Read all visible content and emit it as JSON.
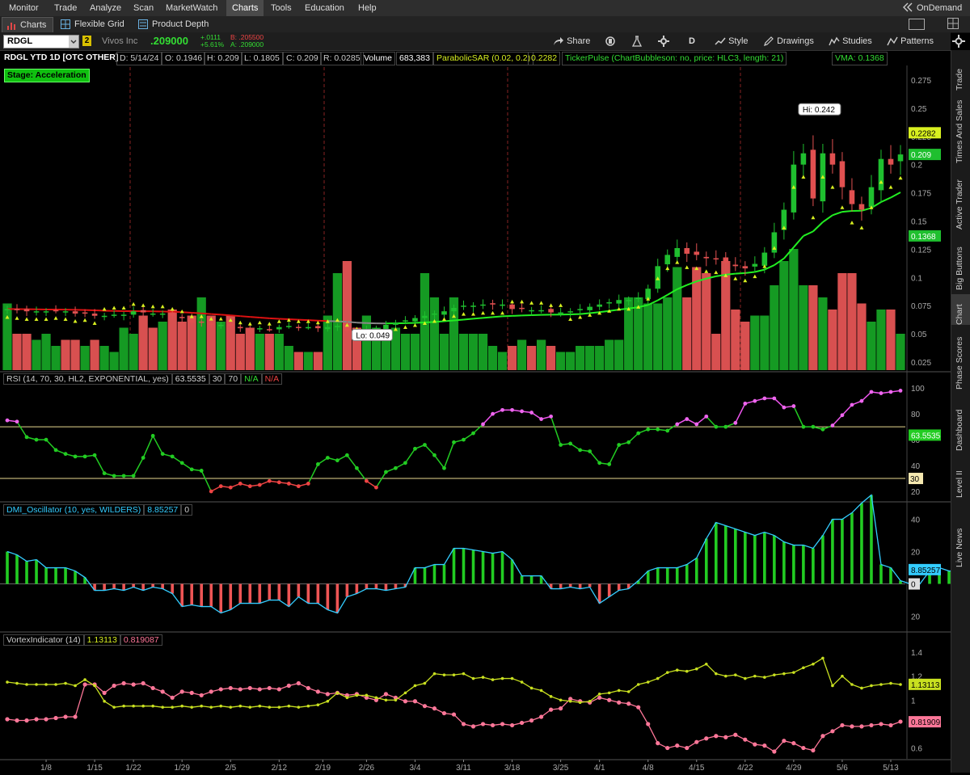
{
  "menubar": {
    "items": [
      "Monitor",
      "Trade",
      "Analyze",
      "Scan",
      "MarketWatch",
      "Charts",
      "Tools",
      "Education",
      "Help"
    ],
    "active": "Charts",
    "ondemand": "OnDemand"
  },
  "tabs": [
    "Charts",
    "Flexible Grid",
    "Product Depth"
  ],
  "symbol_bar": {
    "symbol": "RDGL",
    "link_badge": "2",
    "company": "Vivos Inc",
    "last": ".209000",
    "change": "+.0111",
    "change_pct": "+5.61%",
    "bid": "B: .205500",
    "ask": "A: .209000",
    "share": "Share",
    "period": "D",
    "style": "Style",
    "drawings": "Drawings",
    "studies": "Studies",
    "patterns": "Patterns"
  },
  "study_header": {
    "title": "RDGL YTD 1D [OTC OTHER]",
    "date": "D: 5/14/24",
    "open": "O: 0.1946",
    "high": "H: 0.209",
    "low": "L: 0.1805",
    "close": "C: 0.209",
    "range": "R: 0.0285",
    "volume_label": "Volume",
    "volume": "683,383",
    "psar_label": "ParabolicSAR (0.02, 0.2)",
    "psar": "0.2282",
    "tickerpulse": "TickerPulse (ChartBubbleson: no, price: HLC3, length: 21)",
    "vma": "VMA: 0.1368"
  },
  "stage_label": "Stage: Acceleration",
  "price_panel": {
    "y_ticks": [
      "0.275",
      "0.25",
      "0.225",
      "0.2",
      "0.175",
      "0.15",
      "0.125",
      "0.1",
      "0.075",
      "0.05",
      "0.025"
    ],
    "hi_bubble": "Hi: 0.242",
    "lo_bubble": "Lo: 0.049",
    "tag_psar": "0.2282",
    "tag_last": "0.209",
    "tag_vma": "0.1368",
    "colors": {
      "up": "#18a828",
      "down": "#e04848",
      "psar": "#d8f020",
      "vma_up": "#22ee22",
      "vma_down": "#dd1111"
    }
  },
  "rsi_panel": {
    "label": "RSI (14, 70, 30, HL2, EXPONENTIAL, yes)",
    "value": "63.5535",
    "ob": "30",
    "os": "70",
    "na1": "N/A",
    "na2": "N/A",
    "y_ticks": [
      "100",
      "80",
      "60",
      "40",
      "20"
    ],
    "tag_value": "63.5535",
    "tag_os": "30"
  },
  "dmi_panel": {
    "label": "DMI_Oscillator (10, yes, WILDERS)",
    "value": "8.85257",
    "zero": "0",
    "y_ticks": [
      "40",
      "20",
      "20"
    ],
    "tag_value": "8.85257",
    "tag_zero": "0"
  },
  "vortex_panel": {
    "label": "VortexIndicator (14)",
    "vi_plus": "1.13113",
    "vi_minus": "0.819087",
    "y_ticks": [
      "1.4",
      "1.2",
      "1",
      "0.8",
      "0.6"
    ],
    "tag_plus": "1.13113",
    "tag_minus": "0.81909"
  },
  "x_axis": [
    "1/8",
    "1/15",
    "1/22",
    "1/29",
    "2/5",
    "2/12",
    "2/19",
    "2/26",
    "3/4",
    "3/11",
    "3/18",
    "3/25",
    "4/1",
    "4/8",
    "4/15",
    "4/22",
    "4/29",
    "5/6",
    "5/13"
  ],
  "right_panel": [
    "Trade",
    "Times And Sales",
    "Active Trader",
    "Big Buttons",
    "Chart",
    "Phase Scores",
    "Dashboard",
    "Level II",
    "Live News"
  ],
  "right_panel_active": "Chart",
  "chart_data": {
    "type": "candlestick",
    "dates": [
      "1/2",
      "1/3",
      "1/4",
      "1/5",
      "1/8",
      "1/9",
      "1/10",
      "1/11",
      "1/12",
      "1/16",
      "1/17",
      "1/18",
      "1/19",
      "1/22",
      "1/23",
      "1/24",
      "1/25",
      "1/26",
      "1/29",
      "1/30",
      "1/31",
      "2/1",
      "2/2",
      "2/5",
      "2/6",
      "2/7",
      "2/8",
      "2/9",
      "2/12",
      "2/13",
      "2/14",
      "2/15",
      "2/16",
      "2/20",
      "2/21",
      "2/22",
      "2/23",
      "2/26",
      "2/27",
      "2/28",
      "2/29",
      "3/1",
      "3/4",
      "3/5",
      "3/6",
      "3/7",
      "3/8",
      "3/11",
      "3/12",
      "3/13",
      "3/14",
      "3/15",
      "3/18",
      "3/19",
      "3/20",
      "3/21",
      "3/22",
      "3/25",
      "3/26",
      "3/27",
      "3/28",
      "4/1",
      "4/2",
      "4/3",
      "4/4",
      "4/5",
      "4/8",
      "4/9",
      "4/10",
      "4/11",
      "4/12",
      "4/15",
      "4/16",
      "4/17",
      "4/18",
      "4/19",
      "4/22",
      "4/23",
      "4/24",
      "4/25",
      "4/26",
      "4/29",
      "4/30",
      "5/1",
      "5/2",
      "5/3",
      "5/6",
      "5/7",
      "5/8",
      "5/9",
      "5/10",
      "5/13",
      "5/14"
    ],
    "close": [
      0.072,
      0.071,
      0.07,
      0.07,
      0.07,
      0.071,
      0.07,
      0.068,
      0.069,
      0.066,
      0.066,
      0.067,
      0.067,
      0.07,
      0.069,
      0.068,
      0.068,
      0.066,
      0.064,
      0.06,
      0.06,
      0.058,
      0.058,
      0.057,
      0.055,
      0.054,
      0.055,
      0.054,
      0.056,
      0.057,
      0.056,
      0.056,
      0.055,
      0.056,
      0.057,
      0.053,
      0.05,
      0.054,
      0.055,
      0.058,
      0.06,
      0.062,
      0.064,
      0.066,
      0.068,
      0.07,
      0.073,
      0.075,
      0.075,
      0.076,
      0.076,
      0.076,
      0.072,
      0.072,
      0.071,
      0.071,
      0.069,
      0.069,
      0.07,
      0.072,
      0.074,
      0.076,
      0.078,
      0.08,
      0.08,
      0.082,
      0.09,
      0.11,
      0.12,
      0.126,
      0.121,
      0.12,
      0.117,
      0.116,
      0.113,
      0.11,
      0.108,
      0.112,
      0.122,
      0.14,
      0.16,
      0.2,
      0.21,
      0.17,
      0.21,
      0.2,
      0.18,
      0.165,
      0.16,
      0.18,
      0.205,
      0.2,
      0.209
    ],
    "volume_rel": [
      0.55,
      0.3,
      0.3,
      0.25,
      0.3,
      0.2,
      0.25,
      0.25,
      0.2,
      0.25,
      0.2,
      0.15,
      0.35,
      0.3,
      0.45,
      0.35,
      0.4,
      0.5,
      0.4,
      0.45,
      0.6,
      0.45,
      0.4,
      0.45,
      0.3,
      0.35,
      0.3,
      0.3,
      0.3,
      0.2,
      0.15,
      0.15,
      0.15,
      0.45,
      0.8,
      0.9,
      0.35,
      0.45,
      0.35,
      0.3,
      0.35,
      0.3,
      0.3,
      0.8,
      0.6,
      0.3,
      0.6,
      0.3,
      0.3,
      0.3,
      0.2,
      0.15,
      0.2,
      0.25,
      0.2,
      0.25,
      0.2,
      0.15,
      0.15,
      0.2,
      0.2,
      0.2,
      0.25,
      0.25,
      0.6,
      0.6,
      0.55,
      0.55,
      0.6,
      0.85,
      0.6,
      0.85,
      0.8,
      0.3,
      0.9,
      0.5,
      0.4,
      0.45,
      0.45,
      0.7,
      0.9,
      1.0,
      0.7,
      0.7,
      0.6,
      0.5,
      0.8,
      0.8,
      0.55,
      0.4,
      0.5,
      0.5,
      0.3
    ],
    "rsi": [
      75,
      74,
      62,
      60,
      60,
      52,
      49,
      47,
      47,
      48,
      34,
      32,
      32,
      32,
      46,
      63,
      49,
      47,
      42,
      37,
      36,
      20,
      24,
      23,
      26,
      24,
      25,
      28,
      27,
      26,
      24,
      26,
      41,
      46,
      44,
      48,
      38,
      28,
      23,
      35,
      38,
      42,
      53,
      56,
      48,
      38,
      58,
      60,
      65,
      72,
      80,
      83,
      83,
      82,
      81,
      76,
      78,
      56,
      57,
      52,
      51,
      42,
      41,
      56,
      58,
      65,
      68,
      68,
      67,
      72,
      76,
      72,
      78,
      70,
      70,
      73,
      88,
      90,
      92,
      92,
      85,
      86,
      70,
      70,
      68,
      71,
      79,
      87,
      90,
      97,
      96,
      97,
      98
    ],
    "dmi": [
      20,
      18,
      14,
      15,
      10,
      10,
      10,
      8,
      4,
      -4,
      -4,
      -3,
      -4,
      -2,
      -4,
      -2,
      -3,
      -6,
      -14,
      -13,
      -14,
      -14,
      -18,
      -16,
      -12,
      -12,
      -12,
      -10,
      -10,
      -14,
      -8,
      -12,
      -12,
      -16,
      -18,
      -8,
      -6,
      -3,
      -3,
      -4,
      -3,
      -2,
      10,
      10,
      12,
      12,
      22,
      22,
      21,
      20,
      19,
      20,
      15,
      5,
      5,
      5,
      -3,
      -3,
      -2,
      -3,
      -2,
      -12,
      -8,
      -4,
      -3,
      2,
      8,
      10,
      10,
      10,
      12,
      16,
      28,
      38,
      36,
      34,
      32,
      30,
      32,
      30,
      26,
      24,
      24,
      22,
      30,
      40,
      40,
      44,
      50,
      55,
      12,
      10,
      2,
      0,
      0,
      8,
      10,
      8,
      8
    ],
    "vi_plus": [
      1.15,
      1.14,
      1.13,
      1.13,
      1.13,
      1.13,
      1.14,
      1.12,
      1.17,
      1.12,
      0.99,
      0.94,
      0.95,
      0.95,
      0.95,
      0.95,
      0.94,
      0.94,
      0.95,
      0.94,
      0.95,
      0.94,
      0.95,
      0.94,
      0.95,
      0.94,
      0.95,
      0.94,
      0.94,
      0.95,
      0.94,
      0.95,
      0.96,
      0.99,
      1.06,
      1.02,
      1.04,
      1.04,
      1.02,
      1.0,
      1.0,
      1.06,
      1.12,
      1.14,
      1.22,
      1.21,
      1.21,
      1.22,
      1.18,
      1.19,
      1.17,
      1.18,
      1.18,
      1.15,
      1.1,
      1.08,
      1.03,
      1.0,
      0.99,
      0.98,
      0.99,
      1.05,
      1.06,
      1.08,
      1.07,
      1.13,
      1.15,
      1.18,
      1.23,
      1.25,
      1.24,
      1.26,
      1.3,
      1.22,
      1.2,
      1.21,
      1.18,
      1.2,
      1.19,
      1.21,
      1.22,
      1.23,
      1.27,
      1.3,
      1.35,
      1.12,
      1.2,
      1.13,
      1.1,
      1.12,
      1.13,
      1.14,
      1.13
    ],
    "vi_minus": [
      0.84,
      0.83,
      0.83,
      0.84,
      0.84,
      0.85,
      0.86,
      0.86,
      1.13,
      1.13,
      1.06,
      1.12,
      1.14,
      1.13,
      1.14,
      1.1,
      1.07,
      1.02,
      1.07,
      1.06,
      1.04,
      1.07,
      1.09,
      1.1,
      1.09,
      1.1,
      1.09,
      1.1,
      1.09,
      1.12,
      1.14,
      1.1,
      1.07,
      1.05,
      1.06,
      1.04,
      1.05,
      1.02,
      1.0,
      1.05,
      1.02,
      0.99,
      0.99,
      0.95,
      0.93,
      0.89,
      0.88,
      0.8,
      0.78,
      0.8,
      0.79,
      0.8,
      0.79,
      0.81,
      0.83,
      0.86,
      0.92,
      0.93,
      1.01,
      0.99,
      0.98,
      1.02,
      1.0,
      0.98,
      0.97,
      0.94,
      0.8,
      0.64,
      0.6,
      0.62,
      0.6,
      0.65,
      0.68,
      0.7,
      0.69,
      0.71,
      0.67,
      0.63,
      0.62,
      0.57,
      0.66,
      0.64,
      0.6,
      0.58,
      0.7,
      0.74,
      0.79,
      0.78,
      0.78,
      0.79,
      0.8,
      0.79,
      0.82
    ]
  }
}
